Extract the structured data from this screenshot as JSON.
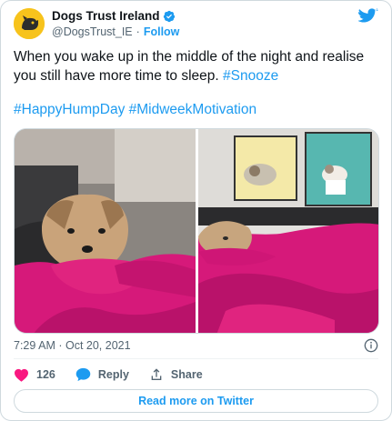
{
  "author": {
    "display_name": "Dogs Trust Ireland",
    "handle": "@DogsTrust_IE",
    "separator": "·",
    "follow_label": "Follow",
    "verified": true
  },
  "tweet": {
    "text_line": "When you wake up in the middle of the night and realise you still have more time to sleep.",
    "inline_hashtag": "#Snooze",
    "hashtags": "#HappyHumpDay #MidweekMotivation",
    "timestamp": "7:29 AM · Oct 20, 2021"
  },
  "media": {
    "photos": [
      {
        "icon": "dog-under-pink-blanket-photo"
      },
      {
        "icon": "dog-sleeping-with-posters-photo"
      }
    ]
  },
  "actions": {
    "like_count": "126",
    "reply_label": "Reply",
    "share_label": "Share"
  },
  "footer": {
    "read_more_label": "Read more on Twitter"
  },
  "colors": {
    "accent": "#1d9bf0",
    "like": "#f91880",
    "muted": "#536471",
    "avatar_bg": "#f7c31c",
    "blanket": "#d6197a"
  }
}
